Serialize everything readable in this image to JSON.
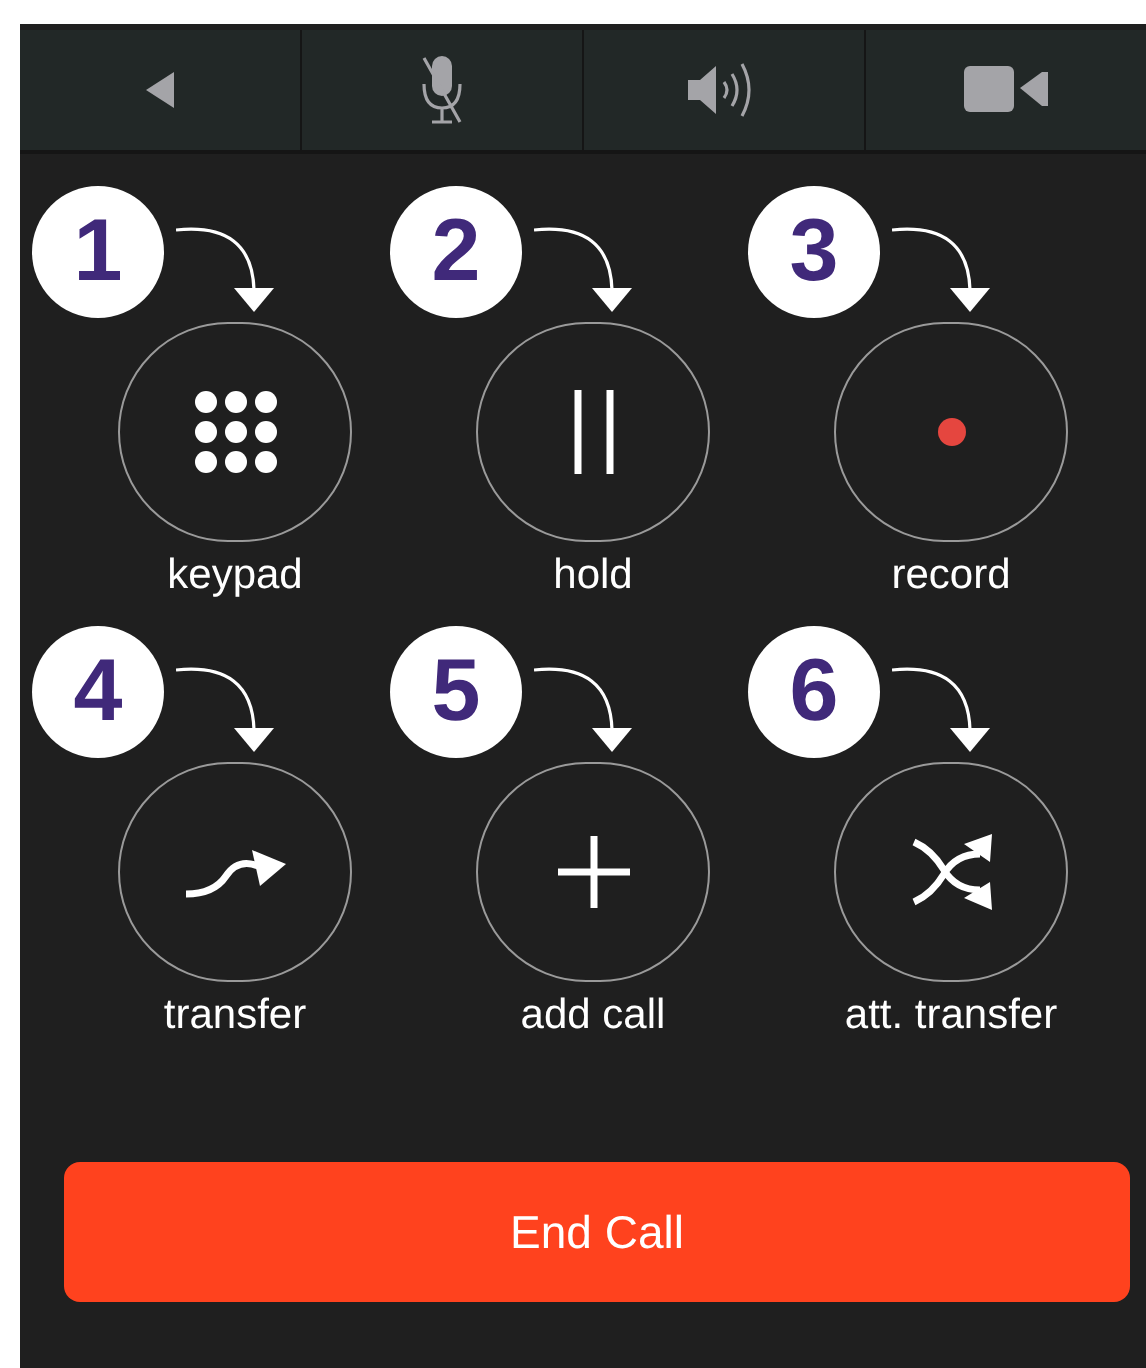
{
  "toolbar": [
    {
      "kind": "back"
    },
    {
      "kind": "mic-off"
    },
    {
      "kind": "speaker"
    },
    {
      "kind": "video"
    }
  ],
  "actions": [
    {
      "badge": "1",
      "label": "keypad",
      "kind": "keypad"
    },
    {
      "badge": "2",
      "label": "hold",
      "kind": "hold"
    },
    {
      "badge": "3",
      "label": "record",
      "kind": "record"
    },
    {
      "badge": "4",
      "label": "transfer",
      "kind": "transfer"
    },
    {
      "badge": "5",
      "label": "add call",
      "kind": "add"
    },
    {
      "badge": "6",
      "label": "att. transfer",
      "kind": "att-transfer"
    }
  ],
  "end_button": {
    "label": "End Call"
  }
}
